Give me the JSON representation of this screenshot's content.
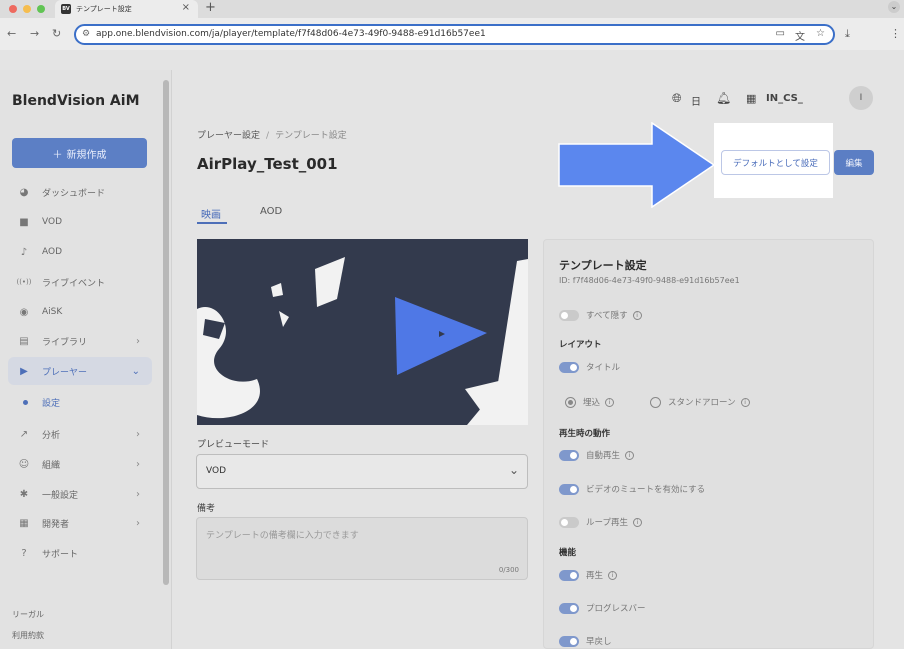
{
  "browser": {
    "tab_title": "テンプレート設定",
    "favicon": "BV",
    "url": "app.one.blendvision.com/ja/player/template/f7f48d06-4e73-49f0-9488-e91d16b57ee1",
    "traffic_colors": [
      "#ee6a5f",
      "#f5bd4f",
      "#61c454"
    ]
  },
  "sidebar": {
    "logo": "BlendVision AiM",
    "new_button": "新規作成",
    "items": [
      {
        "label": "ダッシュボード",
        "icon": "dashboard-icon",
        "glyph": "◕"
      },
      {
        "label": "VOD",
        "icon": "video-icon",
        "glyph": "■"
      },
      {
        "label": "AOD",
        "icon": "music-note-icon",
        "glyph": "♪"
      },
      {
        "label": "ライブイベント",
        "icon": "live-icon",
        "glyph": "((•))"
      },
      {
        "label": "AiSK",
        "icon": "ai-icon",
        "glyph": "◉"
      },
      {
        "label": "ライブラリ",
        "icon": "library-icon",
        "glyph": "▤"
      },
      {
        "label": "プレーヤー",
        "icon": "player-icon",
        "glyph": "▶"
      },
      {
        "label": "分析",
        "icon": "analytics-icon",
        "glyph": "↗"
      },
      {
        "label": "組織",
        "icon": "organization-icon",
        "glyph": "☺"
      },
      {
        "label": "一般設定",
        "icon": "settings-icon",
        "glyph": "✱"
      },
      {
        "label": "開発者",
        "icon": "developer-icon",
        "glyph": "▦"
      },
      {
        "label": "サポート",
        "icon": "support-icon",
        "glyph": "?"
      }
    ],
    "sub_item": "設定",
    "legal": [
      "リーガル",
      "利用約款"
    ]
  },
  "header": {
    "lang": "日",
    "org": "IN_CS_",
    "avatar": "I"
  },
  "main": {
    "breadcrumb": [
      "プレーヤー設定",
      "テンプレート設定"
    ],
    "title": "AirPlay_Test_001",
    "default_button": "デフォルトとして設定",
    "edit_button": "編集",
    "tabs": [
      "映画",
      "AOD"
    ],
    "preview_mode_label": "プレビューモード",
    "preview_mode_value": "VOD",
    "notes_label": "備考",
    "notes_placeholder": "テンプレートの備考欄に入力できます",
    "notes_count": "0/300"
  },
  "panel": {
    "title": "テンプレート設定",
    "id": "ID: f7f48d06-4e73-49f0-9488-e91d16b57ee1",
    "hide_all": "すべて隠す",
    "layout_title": "レイアウト",
    "title_toggle": "タイトル",
    "radio_embed": "埋込",
    "radio_standalone": "スタンドアローン",
    "playback_title": "再生時の動作",
    "autoplay": "自動再生",
    "mute": "ビデオのミュートを有効にする",
    "loop": "ループ再生",
    "features_title": "機能",
    "play": "再生",
    "progress": "プログレスバー",
    "rewind": "早戻し"
  },
  "colors": {
    "accent": "#4d6fb8",
    "primary_button": "#5b7ec4",
    "arrow": "#5b87ee",
    "preview_bg": "#333a4d"
  }
}
